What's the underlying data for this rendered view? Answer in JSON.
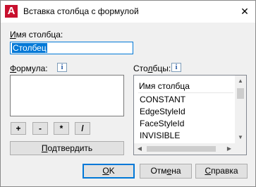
{
  "window": {
    "title": "Вставка столбца с формулой",
    "close_glyph": "✕",
    "app_icon_letter": "A",
    "app_icon": "autocad-logo-icon"
  },
  "name_field": {
    "label_underlined": "И",
    "label_rest": "мя столбца:",
    "value": "Столбец"
  },
  "formula": {
    "label_underlined": "Ф",
    "label_rest": "ормула:",
    "info_glyph": "i",
    "value": ""
  },
  "operators": [
    "+",
    "-",
    "*",
    "/"
  ],
  "confirm_button": {
    "underlined": "П",
    "rest": "одтвердить"
  },
  "columns": {
    "label_pre": "Сто",
    "label_underlined": "л",
    "label_post": "бцы:",
    "info_glyph": "i",
    "header": "Имя столбца",
    "items": [
      "CONSTANT",
      "EdgeStyleId",
      "FaceStyleId",
      "INVISIBLE"
    ]
  },
  "scroll_glyphs": {
    "up": "▲",
    "down": "▼",
    "left": "◀",
    "right": "▶"
  },
  "buttons": {
    "ok": {
      "underlined": "О",
      "rest": "K"
    },
    "cancel": {
      "pre": "Отм",
      "underlined": "е",
      "post": "на"
    },
    "help": {
      "underlined": "С",
      "rest": "правка"
    }
  },
  "colors": {
    "accent": "#0078d7",
    "app_icon_bg": "#c8102e"
  }
}
